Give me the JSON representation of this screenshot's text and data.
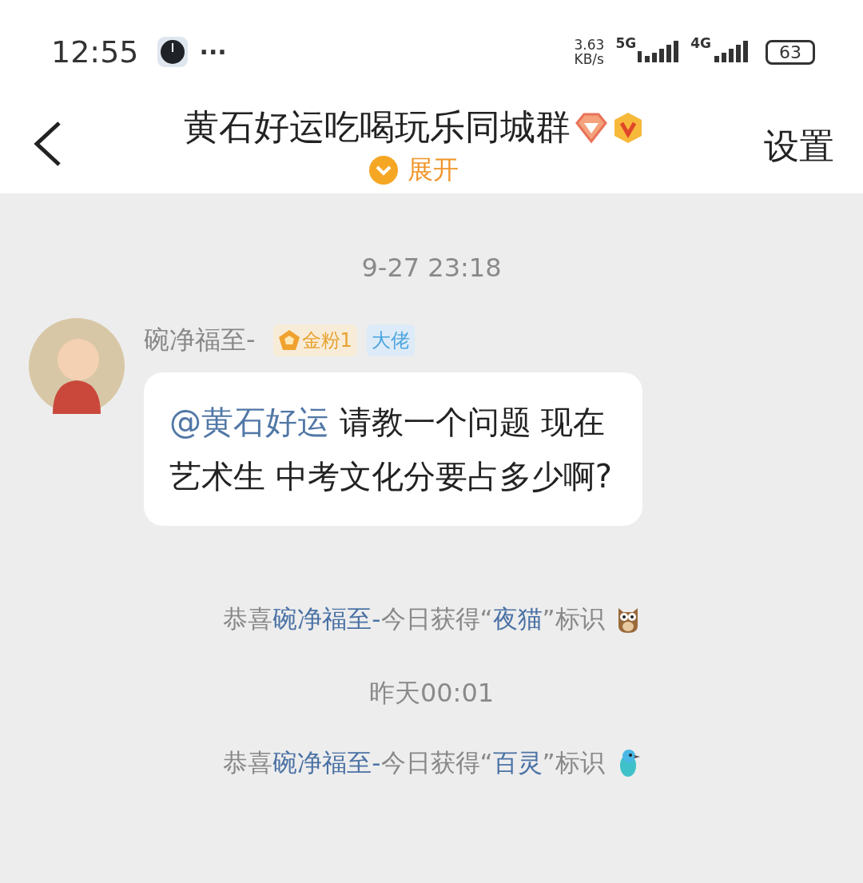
{
  "status_bar": {
    "time": "12:55",
    "more": "···",
    "speed_value": "3.63",
    "speed_unit": "KB/s",
    "network_1": "5G",
    "network_2": "4G",
    "battery": "63"
  },
  "header": {
    "title": "黄石好运吃喝玩乐同城群",
    "expand": "展开",
    "settings": "设置"
  },
  "messages": [
    {
      "kind": "time",
      "text": "9-27 23:18"
    },
    {
      "kind": "chat",
      "sender": "碗净福至-",
      "badges": [
        {
          "kind": "fan",
          "text": "金粉1"
        },
        {
          "kind": "title",
          "text": "大佬"
        }
      ],
      "parts": [
        {
          "kind": "mention",
          "text": "@黄石好运"
        },
        {
          "kind": "plain",
          "text": " 请教一个问题 现在艺术生 中考文化分要占多少啊?"
        }
      ]
    },
    {
      "kind": "notice",
      "parts": [
        {
          "kind": "plain",
          "text": "恭喜"
        },
        {
          "kind": "name",
          "text": "碗净福至-"
        },
        {
          "kind": "plain",
          "text": "今日获得“"
        },
        {
          "kind": "name",
          "text": "夜猫"
        },
        {
          "kind": "plain",
          "text": "”标识"
        }
      ]
    },
    {
      "kind": "time",
      "text": "昨天00:01"
    },
    {
      "kind": "notice",
      "parts": [
        {
          "kind": "plain",
          "text": "恭喜"
        },
        {
          "kind": "name",
          "text": "碗净福至-"
        },
        {
          "kind": "plain",
          "text": "今日获得“"
        },
        {
          "kind": "name",
          "text": "百灵"
        },
        {
          "kind": "plain",
          "text": "”标识"
        }
      ]
    }
  ]
}
